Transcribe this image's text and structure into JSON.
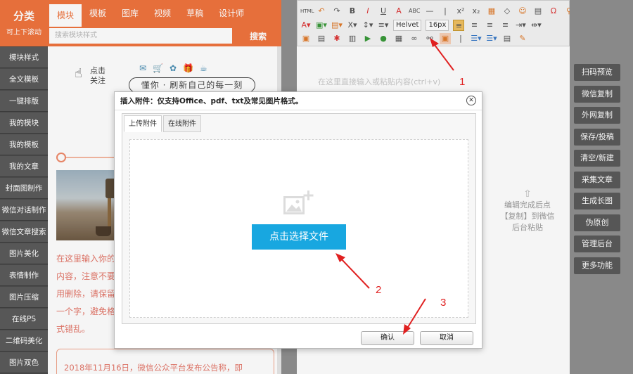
{
  "sidebar": {
    "title": "分类",
    "subtitle": "可上下滚动",
    "items": [
      "模块样式",
      "全文模板",
      "一键排版",
      "我的模块",
      "我的模板",
      "我的文章",
      "封面图制作",
      "微信对话制作",
      "微信文章搜索",
      "图片美化",
      "表情制作",
      "图片压缩",
      "在线PS",
      "二维码美化",
      "图片双色"
    ]
  },
  "style_panel": {
    "tabs": [
      "模块",
      "模板",
      "图库",
      "视频",
      "草稿",
      "设计师"
    ],
    "active_tab": "模块",
    "search_placeholder": "搜索模块样式",
    "search_button": "搜索",
    "banner_small": "点击\n关注",
    "banner_slogan": "懂你 · 刷新自己的每一刻",
    "sample_text": "在这里输入你的内容，注意不要用删除，请保留一个字，避免格式错乱。",
    "date_text": "2018年11月16日，微信公众平台发布公告称，即"
  },
  "toolbar": {
    "font_name": "Helvet",
    "font_size": "16px"
  },
  "editor": {
    "placeholder": "在这里直接输入或粘贴内容(ctrl+v)",
    "hint": "编辑完成后点【复制】到微信后台粘贴"
  },
  "right_buttons": [
    "扫码预览",
    "微信复制",
    "外网复制",
    "保存/投稿",
    "清空/新建",
    "采集文章",
    "生成长图",
    "伪原创",
    "管理后台",
    "更多功能"
  ],
  "dialog": {
    "title": "插入附件：仅支持Office、pdf、txt及常见图片格式。",
    "tabs": [
      "上传附件",
      "在线附件"
    ],
    "choose_button": "点击选择文件",
    "confirm": "确认",
    "cancel": "取消"
  },
  "annotations": [
    "1",
    "2",
    "3"
  ],
  "colors": {
    "accent": "#f0743e",
    "button_blue": "#18a7e0",
    "annotation_red": "#e02020"
  }
}
